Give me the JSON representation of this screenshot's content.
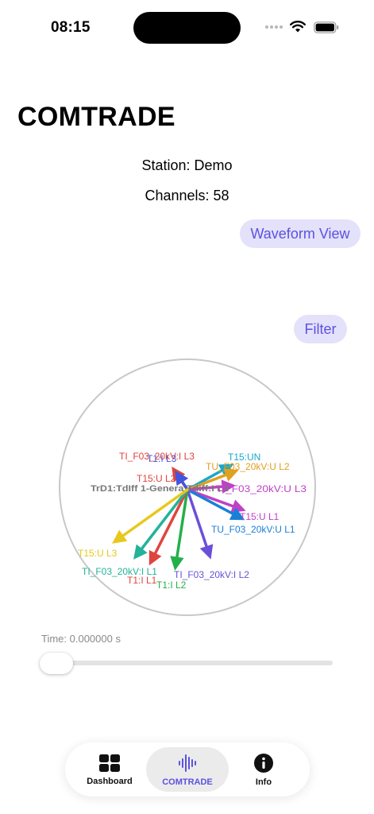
{
  "status_bar": {
    "time": "08:15"
  },
  "header": {
    "title": "COMTRADE"
  },
  "info": {
    "station": "Station: Demo",
    "channels": "Channels: 58"
  },
  "buttons": {
    "waveform": "Waveform View",
    "filter": "Filter"
  },
  "phasor_labels": [
    {
      "text": "TI_F03_20kV:I L3",
      "color": "#e0443e"
    },
    {
      "text": "T1:I L3",
      "color": "#4455dd"
    },
    {
      "text": "T15:UN",
      "color": "#1aa7c9"
    },
    {
      "text": "TU_F03_20kV:U L2",
      "color": "#e0a020"
    },
    {
      "text": "T15:U L2",
      "color": "#e0443e"
    },
    {
      "text": "TrD1:TdIff 1-Genera Tdiff:I L2",
      "color": "#777777"
    },
    {
      "text": "TI_F03_20kV:U L3",
      "color": "#c040c8"
    },
    {
      "text": "T15:U L1",
      "color": "#c040c8"
    },
    {
      "text": "TU_F03_20kV:U L1",
      "color": "#1a7fd8"
    },
    {
      "text": "T15:U L3",
      "color": "#e8c81e"
    },
    {
      "text": "TI_F03_20kV:I L1",
      "color": "#22b39a"
    },
    {
      "text": "T1:I L1",
      "color": "#e0443e"
    },
    {
      "text": "TI_F03_20kV:I L2",
      "color": "#6a50d8"
    },
    {
      "text": "T1:I L2",
      "color": "#22b04a"
    }
  ],
  "slider": {
    "time_label": "Time: 0.000000 s",
    "position": 0.0
  },
  "tabs": [
    {
      "label": "Dashboard",
      "icon": "grid-icon",
      "selected": false
    },
    {
      "label": "COMTRADE",
      "icon": "waveform-icon",
      "selected": true
    },
    {
      "label": "Info",
      "icon": "info-icon",
      "selected": false
    }
  ],
  "colors": {
    "accent": "#5b52e0",
    "pill_bg": "#e4e1fa",
    "circle": "#c8c8c8"
  }
}
